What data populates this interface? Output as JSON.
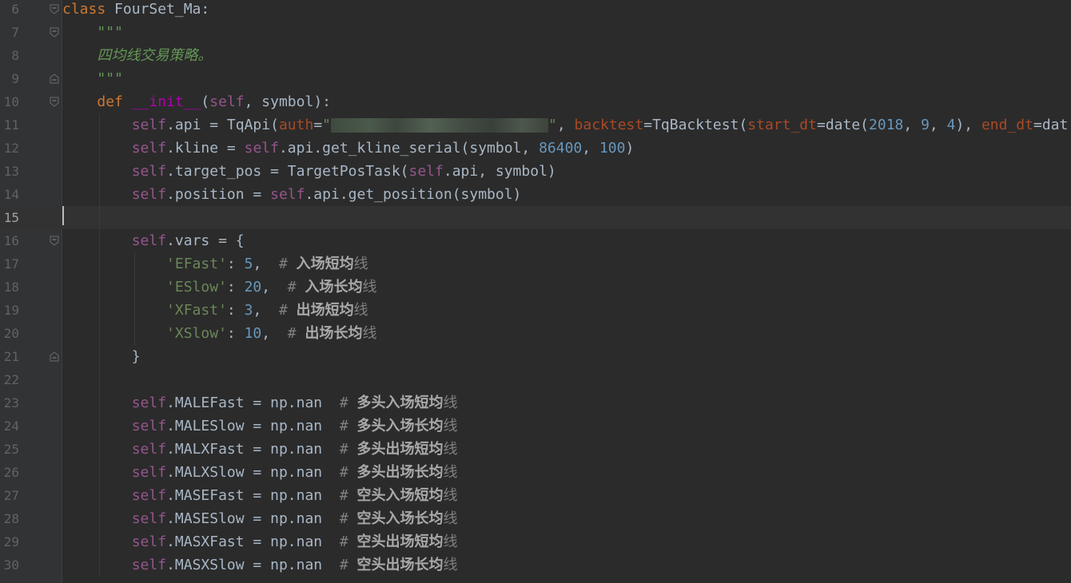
{
  "editor": {
    "background": "#2b2b2b",
    "current_line": 15,
    "lines": [
      {
        "n": "6",
        "fold": "minus",
        "t": [
          [
            "kw",
            "class"
          ],
          [
            "p",
            " FourSet_Ma:"
          ]
        ]
      },
      {
        "n": "7",
        "fold": "minus",
        "t": [
          [
            "p",
            "    "
          ],
          [
            "doc",
            "\"\"\""
          ]
        ]
      },
      {
        "n": "8",
        "fold": "",
        "t": [
          [
            "p",
            "    "
          ],
          [
            "doc",
            "四均线交易策略。"
          ]
        ]
      },
      {
        "n": "9",
        "fold": "end",
        "t": [
          [
            "p",
            "    "
          ],
          [
            "doc",
            "\"\"\""
          ]
        ]
      },
      {
        "n": "10",
        "fold": "minus",
        "t": [
          [
            "p",
            "    "
          ],
          [
            "kw",
            "def"
          ],
          [
            "p",
            " "
          ],
          [
            "magic",
            "__init__"
          ],
          [
            "p",
            "("
          ],
          [
            "self",
            "self"
          ],
          [
            "p",
            ", symbol):"
          ]
        ]
      },
      {
        "n": "11",
        "fold": "",
        "t": [
          [
            "p",
            "        "
          ],
          [
            "self",
            "self"
          ],
          [
            "p",
            ".api = TqApi("
          ],
          [
            "param",
            "auth"
          ],
          [
            "p",
            "="
          ],
          [
            "str",
            "\""
          ],
          [
            "redact",
            ""
          ],
          [
            "str",
            "\""
          ],
          [
            "p",
            ", "
          ],
          [
            "param",
            "backtest"
          ],
          [
            "p",
            "=TqBacktest("
          ],
          [
            "param",
            "start_dt"
          ],
          [
            "p",
            "=date("
          ],
          [
            "num",
            "2018"
          ],
          [
            "p",
            ", "
          ],
          [
            "num",
            "9"
          ],
          [
            "p",
            ", "
          ],
          [
            "num",
            "4"
          ],
          [
            "p",
            "), "
          ],
          [
            "param",
            "end_dt"
          ],
          [
            "p",
            "=dat"
          ]
        ]
      },
      {
        "n": "12",
        "fold": "",
        "t": [
          [
            "p",
            "        "
          ],
          [
            "self",
            "self"
          ],
          [
            "p",
            ".kline = "
          ],
          [
            "self",
            "self"
          ],
          [
            "p",
            ".api.get_kline_serial(symbol, "
          ],
          [
            "num",
            "86400"
          ],
          [
            "p",
            ", "
          ],
          [
            "num",
            "100"
          ],
          [
            "p",
            ")"
          ]
        ]
      },
      {
        "n": "13",
        "fold": "",
        "t": [
          [
            "p",
            "        "
          ],
          [
            "self",
            "self"
          ],
          [
            "p",
            ".target_pos = TargetPosTask("
          ],
          [
            "self",
            "self"
          ],
          [
            "p",
            ".api, symbol)"
          ]
        ]
      },
      {
        "n": "14",
        "fold": "",
        "t": [
          [
            "p",
            "        "
          ],
          [
            "self",
            "self"
          ],
          [
            "p",
            ".position = "
          ],
          [
            "self",
            "self"
          ],
          [
            "p",
            ".api.get_position(symbol)"
          ]
        ]
      },
      {
        "n": "15",
        "fold": "",
        "t": []
      },
      {
        "n": "16",
        "fold": "minus",
        "t": [
          [
            "p",
            "        "
          ],
          [
            "self",
            "self"
          ],
          [
            "p",
            ".vars = {"
          ]
        ]
      },
      {
        "n": "17",
        "fold": "",
        "t": [
          [
            "p",
            "            "
          ],
          [
            "str",
            "'EFast'"
          ],
          [
            "p",
            ": "
          ],
          [
            "num",
            "5"
          ],
          [
            "p",
            ",  "
          ],
          [
            "cmt",
            "# "
          ],
          [
            "cmt-b",
            "入场短均"
          ],
          [
            "cmt",
            "线"
          ]
        ]
      },
      {
        "n": "18",
        "fold": "",
        "t": [
          [
            "p",
            "            "
          ],
          [
            "str",
            "'ESlow'"
          ],
          [
            "p",
            ": "
          ],
          [
            "num",
            "20"
          ],
          [
            "p",
            ",  "
          ],
          [
            "cmt",
            "# "
          ],
          [
            "cmt-b",
            "入场长均"
          ],
          [
            "cmt",
            "线"
          ]
        ]
      },
      {
        "n": "19",
        "fold": "",
        "t": [
          [
            "p",
            "            "
          ],
          [
            "str",
            "'XFast'"
          ],
          [
            "p",
            ": "
          ],
          [
            "num",
            "3"
          ],
          [
            "p",
            ",  "
          ],
          [
            "cmt",
            "# "
          ],
          [
            "cmt-b",
            "出场短均"
          ],
          [
            "cmt",
            "线"
          ]
        ]
      },
      {
        "n": "20",
        "fold": "",
        "t": [
          [
            "p",
            "            "
          ],
          [
            "str",
            "'XSlow'"
          ],
          [
            "p",
            ": "
          ],
          [
            "num",
            "10"
          ],
          [
            "p",
            ",  "
          ],
          [
            "cmt",
            "# "
          ],
          [
            "cmt-b",
            "出场长均"
          ],
          [
            "cmt",
            "线"
          ]
        ]
      },
      {
        "n": "21",
        "fold": "end",
        "t": [
          [
            "p",
            "        }"
          ]
        ]
      },
      {
        "n": "22",
        "fold": "",
        "t": []
      },
      {
        "n": "23",
        "fold": "",
        "t": [
          [
            "p",
            "        "
          ],
          [
            "self",
            "self"
          ],
          [
            "p",
            ".MALEFast = np.nan  "
          ],
          [
            "cmt",
            "# "
          ],
          [
            "cmt-b",
            "多头入场短均"
          ],
          [
            "cmt",
            "线"
          ]
        ]
      },
      {
        "n": "24",
        "fold": "",
        "t": [
          [
            "p",
            "        "
          ],
          [
            "self",
            "self"
          ],
          [
            "p",
            ".MALESlow = np.nan  "
          ],
          [
            "cmt",
            "# "
          ],
          [
            "cmt-b",
            "多头入场长均"
          ],
          [
            "cmt",
            "线"
          ]
        ]
      },
      {
        "n": "25",
        "fold": "",
        "t": [
          [
            "p",
            "        "
          ],
          [
            "self",
            "self"
          ],
          [
            "p",
            ".MALXFast = np.nan  "
          ],
          [
            "cmt",
            "# "
          ],
          [
            "cmt-b",
            "多头出场短均"
          ],
          [
            "cmt",
            "线"
          ]
        ]
      },
      {
        "n": "26",
        "fold": "",
        "t": [
          [
            "p",
            "        "
          ],
          [
            "self",
            "self"
          ],
          [
            "p",
            ".MALXSlow = np.nan  "
          ],
          [
            "cmt",
            "# "
          ],
          [
            "cmt-b",
            "多头出场长均"
          ],
          [
            "cmt",
            "线"
          ]
        ]
      },
      {
        "n": "27",
        "fold": "",
        "t": [
          [
            "p",
            "        "
          ],
          [
            "self",
            "self"
          ],
          [
            "p",
            ".MASEFast = np.nan  "
          ],
          [
            "cmt",
            "# "
          ],
          [
            "cmt-b",
            "空头入场短均"
          ],
          [
            "cmt",
            "线"
          ]
        ]
      },
      {
        "n": "28",
        "fold": "",
        "t": [
          [
            "p",
            "        "
          ],
          [
            "self",
            "self"
          ],
          [
            "p",
            ".MASESlow = np.nan  "
          ],
          [
            "cmt",
            "# "
          ],
          [
            "cmt-b",
            "空头入场长均"
          ],
          [
            "cmt",
            "线"
          ]
        ]
      },
      {
        "n": "29",
        "fold": "",
        "t": [
          [
            "p",
            "        "
          ],
          [
            "self",
            "self"
          ],
          [
            "p",
            ".MASXFast = np.nan  "
          ],
          [
            "cmt",
            "# "
          ],
          [
            "cmt-b",
            "空头出场短均"
          ],
          [
            "cmt",
            "线"
          ]
        ]
      },
      {
        "n": "30",
        "fold": "",
        "t": [
          [
            "p",
            "        "
          ],
          [
            "self",
            "self"
          ],
          [
            "p",
            ".MASXSlow = np.nan  "
          ],
          [
            "cmt",
            "# "
          ],
          [
            "cmt-b",
            "空头出场长均"
          ],
          [
            "cmt",
            "线"
          ]
        ]
      }
    ]
  }
}
